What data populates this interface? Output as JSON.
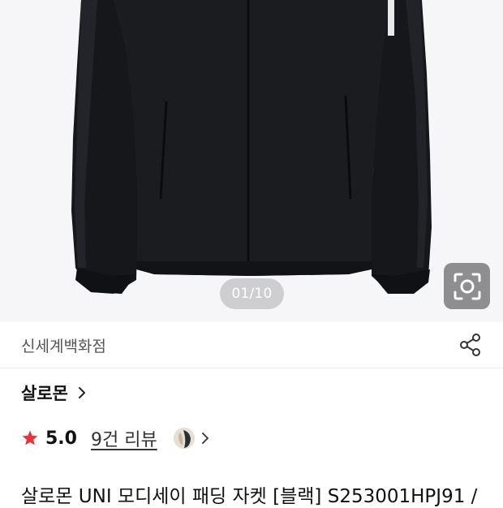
{
  "gallery": {
    "counter": "01/10",
    "lens_icon": "lens-search-icon"
  },
  "store": {
    "name": "신세계백화점",
    "share_icon": "share-icon"
  },
  "brand": {
    "name": "살로몬"
  },
  "rating": {
    "value": "5.0",
    "reviews_label": "9건 리뷰",
    "star_color": "#e8333f"
  },
  "product": {
    "title": "살로몬 UNI 모디세이 패딩 자켓 [블랙] S253001HPJ91 /"
  }
}
